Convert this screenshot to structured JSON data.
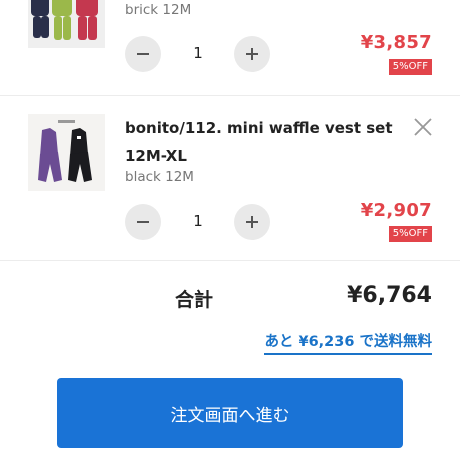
{
  "colors": {
    "price_red": "#e2444a",
    "link_blue": "#1a73c8",
    "button_blue": "#1a73d6",
    "qty_button_gray": "#e9e9e9"
  },
  "items": [
    {
      "variant": "brick 12M",
      "quantity": "1",
      "price": "¥3,857",
      "discount_badge": "5%OFF",
      "icons": [
        "minus-icon",
        "plus-icon"
      ]
    },
    {
      "name": "bonito/112. mini waffle vest set 12M-XL",
      "variant": "black 12M",
      "quantity": "1",
      "price": "¥2,907",
      "discount_badge": "5%OFF",
      "icons": [
        "close-icon",
        "minus-icon",
        "plus-icon"
      ]
    }
  ],
  "summary": {
    "total_label": "合計",
    "total_value": "¥6,764",
    "free_shipping_link": "あと ¥6,236 で送料無料"
  },
  "checkout": {
    "label": "注文画面へ進む"
  }
}
